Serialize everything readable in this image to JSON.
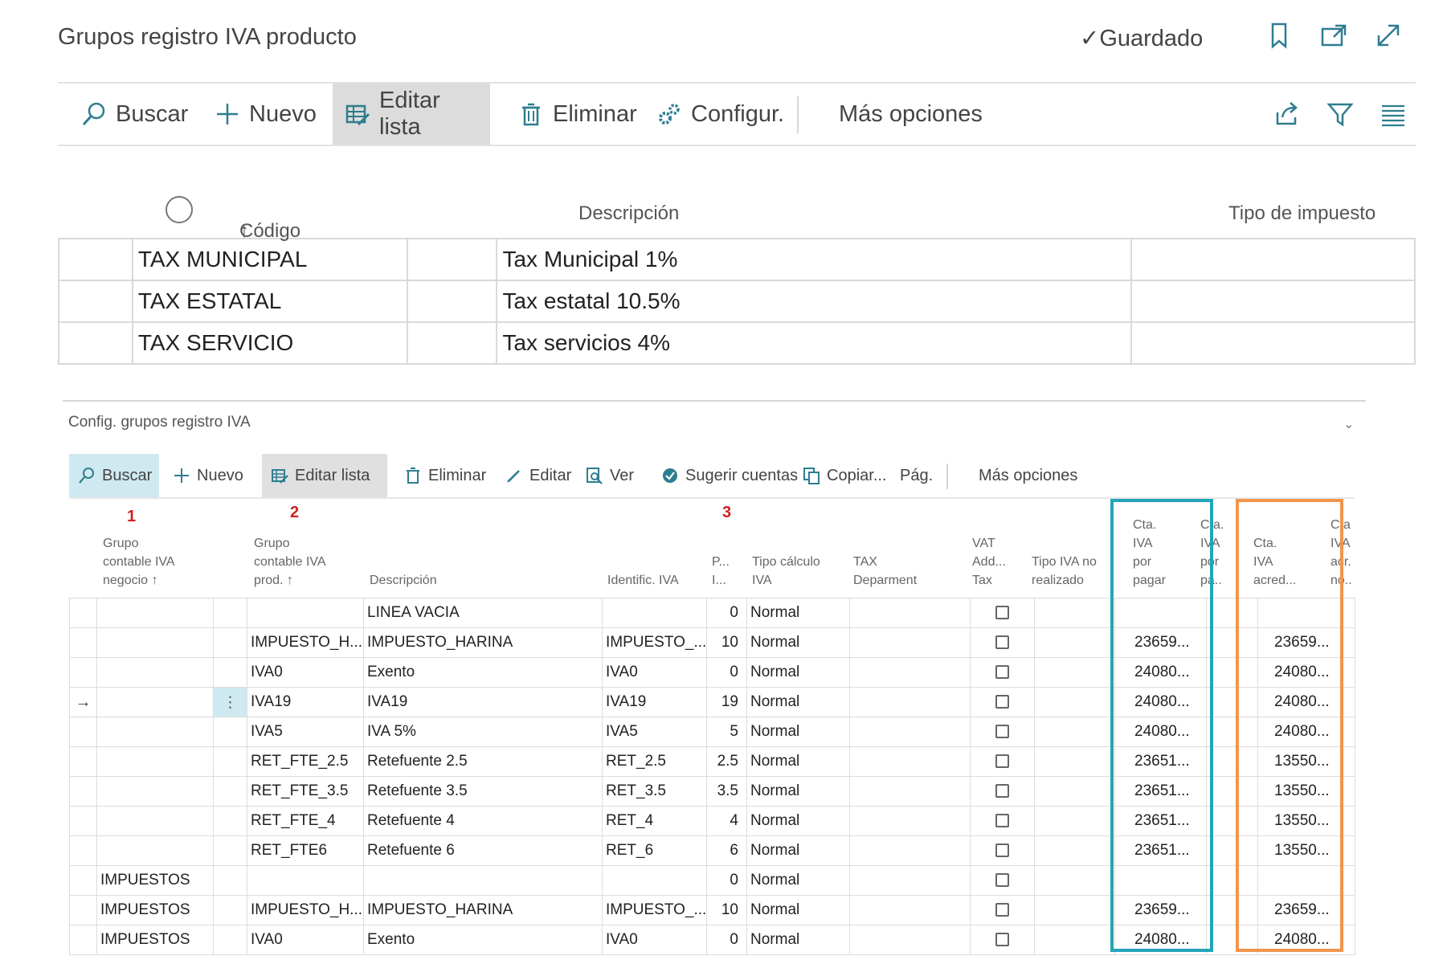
{
  "page": {
    "title": "Grupos registro IVA producto",
    "saved_status": "Guardado"
  },
  "header_icons": [
    "bookmark-icon",
    "open-new-window-icon",
    "expand-icon"
  ],
  "action_bar": {
    "search": "Buscar",
    "new": "Nuevo",
    "edit_list": "Editar lista",
    "delete": "Eliminar",
    "configure": "Configur.",
    "more": "Más opciones"
  },
  "top_list": {
    "columns": [
      "Código",
      "Descripción",
      "Tipo de impuesto"
    ],
    "code_sort": "↑",
    "rows": [
      {
        "code": "TAX MUNICIPAL",
        "description": "Tax Municipal 1%",
        "tax_type": ""
      },
      {
        "code": "TAX ESTATAL",
        "description": "Tax estatal 10.5%",
        "tax_type": ""
      },
      {
        "code": "TAX SERVICIO",
        "description": "Tax servicios 4%",
        "tax_type": ""
      }
    ]
  },
  "subpage": {
    "title": "Config. grupos registro IVA",
    "toolbar": {
      "search": "Buscar",
      "new": "Nuevo",
      "edit_list": "Editar lista",
      "delete": "Eliminar",
      "edit": "Editar",
      "view": "Ver",
      "suggest": "Sugerir cuentas",
      "copy": "Copiar...",
      "page": "Pág.",
      "more": "Más opciones"
    },
    "markers": [
      "1",
      "2",
      "3"
    ],
    "columns": {
      "bus_group": "Grupo\ncontable IVA\nnegocio ↑",
      "prod_group": "Grupo\ncontable IVA\nprod. ↑",
      "description": "Descripción",
      "identifier": "Identific. IVA",
      "pct": "P...\nI...",
      "calc_type": "Tipo cálculo\nIVA",
      "tax_dept": "TAX\nDeparment",
      "vat_add": "VAT\nAdd...\nTax",
      "unrealized": "Tipo IVA no\nrealizado",
      "payable": "Cta.\nIVA\npor\npagar",
      "payable2": "Cta.\nIVA\npor\npa...",
      "deductible": "Cta.\nIVA\nacred...",
      "deductible2": "Cta.\nIVA\nacr.\nno..."
    },
    "rows": [
      {
        "bus": "",
        "prod": "",
        "desc": "LINEA VACIA",
        "id": "",
        "pct": "0",
        "calc": "Normal",
        "payable": "",
        "deductible": "",
        "current": false
      },
      {
        "bus": "",
        "prod": "IMPUESTO_H...",
        "desc": "IMPUESTO_HARINA",
        "id": "IMPUESTO_...",
        "pct": "10",
        "calc": "Normal",
        "payable": "23659...",
        "deductible": "23659...",
        "current": false
      },
      {
        "bus": "",
        "prod": "IVA0",
        "desc": "Exento",
        "id": "IVA0",
        "pct": "0",
        "calc": "Normal",
        "payable": "24080...",
        "deductible": "24080...",
        "current": false
      },
      {
        "bus": "",
        "prod": "IVA19",
        "desc": "IVA19",
        "id": "IVA19",
        "pct": "19",
        "calc": "Normal",
        "payable": "24080...",
        "deductible": "24080...",
        "current": true
      },
      {
        "bus": "",
        "prod": "IVA5",
        "desc": "IVA 5%",
        "id": "IVA5",
        "pct": "5",
        "calc": "Normal",
        "payable": "24080...",
        "deductible": "24080...",
        "current": false
      },
      {
        "bus": "",
        "prod": "RET_FTE_2.5",
        "desc": "Retefuente 2.5",
        "id": "RET_2.5",
        "pct": "2.5",
        "calc": "Normal",
        "payable": "23651...",
        "deductible": "13550...",
        "current": false
      },
      {
        "bus": "",
        "prod": "RET_FTE_3.5",
        "desc": "Retefuente 3.5",
        "id": "RET_3.5",
        "pct": "3.5",
        "calc": "Normal",
        "payable": "23651...",
        "deductible": "13550...",
        "current": false
      },
      {
        "bus": "",
        "prod": "RET_FTE_4",
        "desc": "Retefuente 4",
        "id": "RET_4",
        "pct": "4",
        "calc": "Normal",
        "payable": "23651...",
        "deductible": "13550...",
        "current": false
      },
      {
        "bus": "",
        "prod": "RET_FTE6",
        "desc": "Retefuente 6",
        "id": "RET_6",
        "pct": "6",
        "calc": "Normal",
        "payable": "23651...",
        "deductible": "13550...",
        "current": false
      },
      {
        "bus": "IMPUESTOS",
        "prod": "",
        "desc": "",
        "id": "",
        "pct": "0",
        "calc": "Normal",
        "payable": "",
        "deductible": "",
        "current": false
      },
      {
        "bus": "IMPUESTOS",
        "prod": "IMPUESTO_H...",
        "desc": "IMPUESTO_HARINA",
        "id": "IMPUESTO_...",
        "pct": "10",
        "calc": "Normal",
        "payable": "23659...",
        "deductible": "23659...",
        "current": false
      },
      {
        "bus": "IMPUESTOS",
        "prod": "IVA0",
        "desc": "Exento",
        "id": "IVA0",
        "pct": "0",
        "calc": "Normal",
        "payable": "24080...",
        "deductible": "24080...",
        "current": false
      }
    ]
  },
  "colors": {
    "highlight_blue": "#22a5b8",
    "highlight_orange": "#f2954b",
    "marker_red": "#d21f1f",
    "search_active_bg": "#cfe9f0"
  }
}
